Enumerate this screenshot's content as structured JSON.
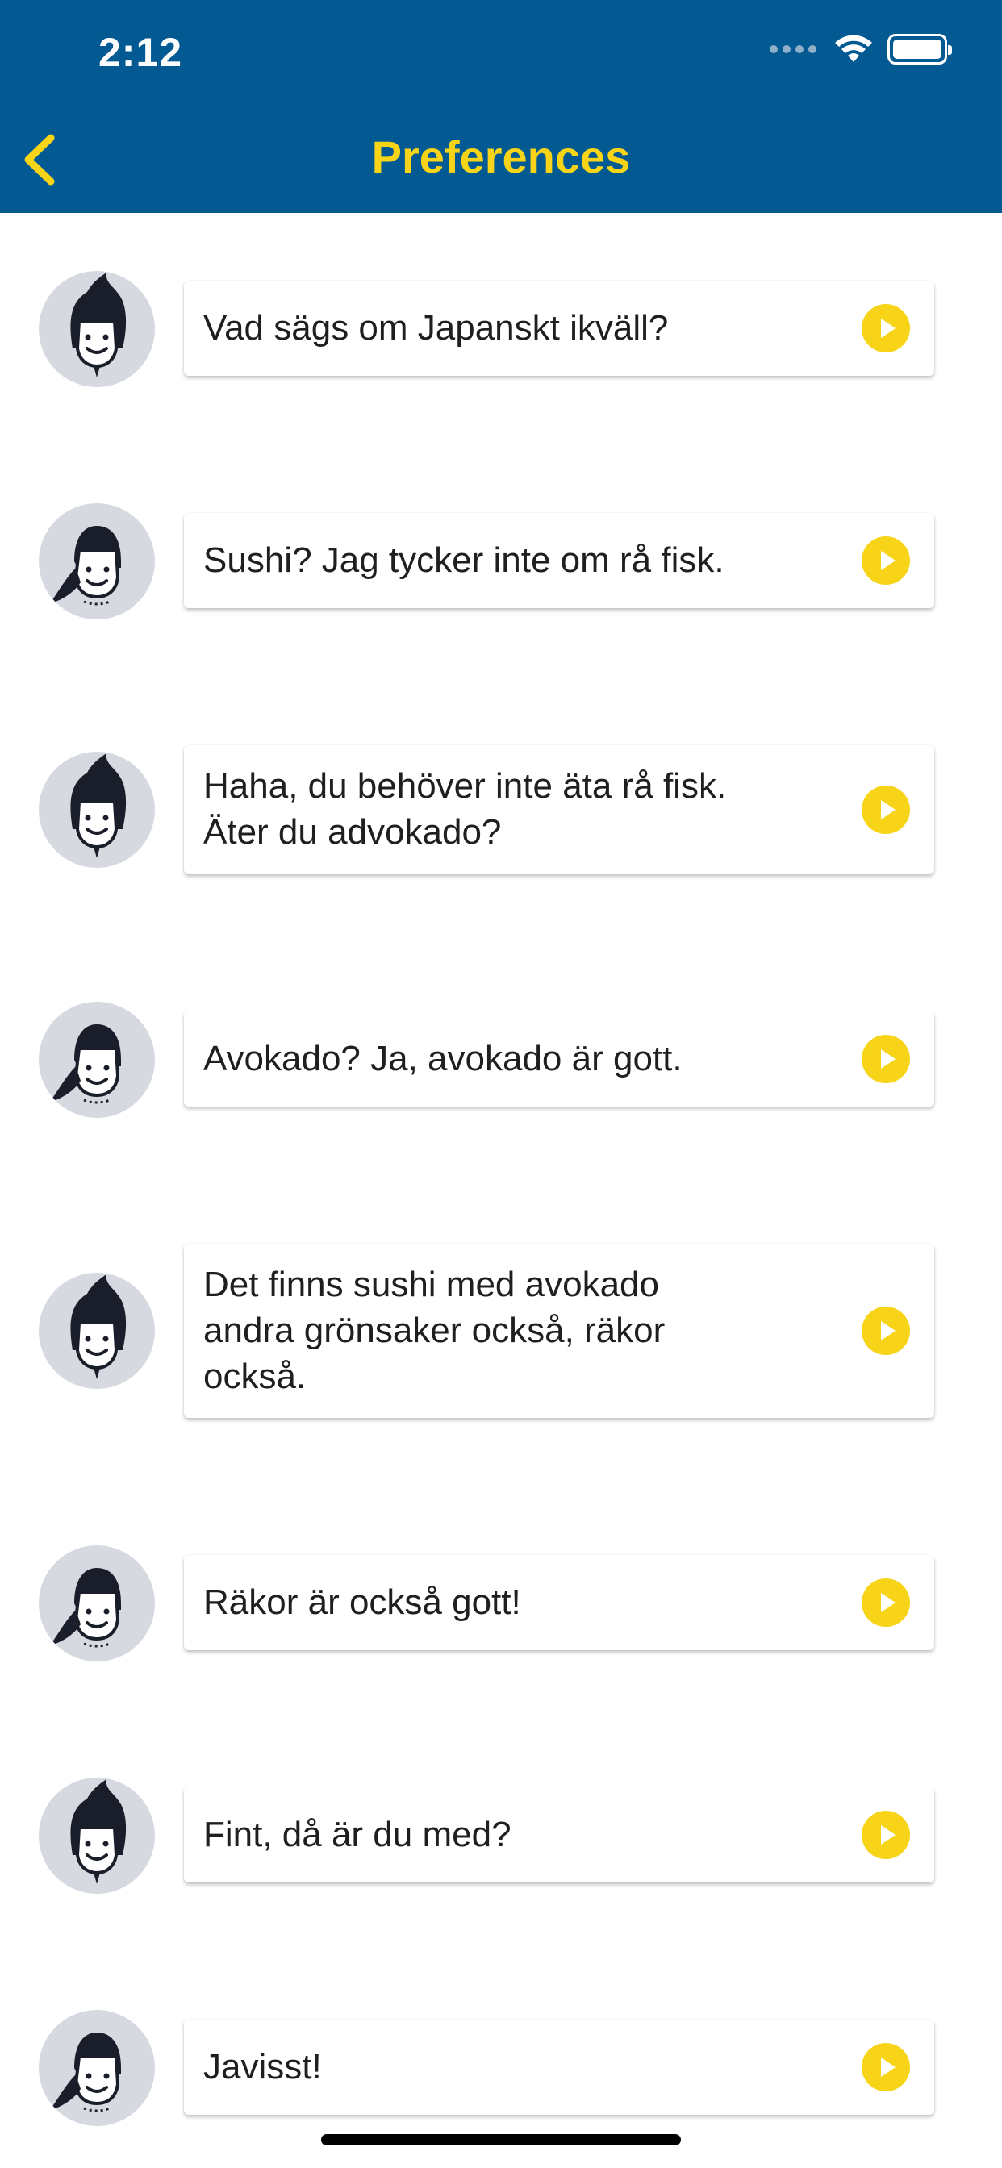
{
  "status_bar": {
    "time": "2:12"
  },
  "header": {
    "title": "Preferences",
    "back_icon": "chevron-left-icon"
  },
  "colors": {
    "header_bg": "#035a93",
    "accent": "#f7d417",
    "avatar_bg": "#d6d9e0"
  },
  "messages": [
    {
      "speaker": "person-a",
      "text": "Vad sägs om Japanskt ikväll?"
    },
    {
      "speaker": "person-b",
      "text": "Sushi? Jag tycker inte om rå fisk."
    },
    {
      "speaker": "person-a",
      "text": "Haha, du behöver inte äta rå fisk. Äter du advokado?"
    },
    {
      "speaker": "person-b",
      "text": "Avokado? Ja, avokado är gott."
    },
    {
      "speaker": "person-a",
      "text": "Det finns sushi med avokado andra grönsaker också, räkor också."
    },
    {
      "speaker": "person-b",
      "text": "Räkor är också gott!"
    },
    {
      "speaker": "person-a",
      "text": "Fint, då är du med?"
    },
    {
      "speaker": "person-b",
      "text": "Javisst!"
    }
  ]
}
